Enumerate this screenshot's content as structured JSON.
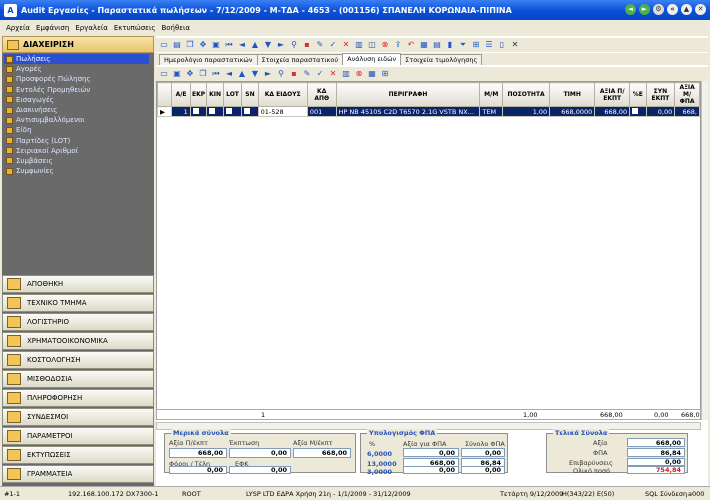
{
  "title": "Audit Εργασίες - Παραστατικά πωλήσεων - 7/12/2009 - Μ-ΤΔΑ - 4653 - (001156) ΣΠΑΝΕΛΗ ΚΟΡΩΝΑΙΑ-ΠΙΠΙΝΑ",
  "menu": [
    "Αρχεία",
    "Εμφάνιση",
    "Εργαλεία",
    "Εκτυπώσεις",
    "Βοήθεια"
  ],
  "sidebar": {
    "header": "ΔΙΑΧΕΙΡΙΣΗ",
    "items": [
      "Πωλήσεις",
      "Αγορές",
      "Προσφορές Πώλησης",
      "Εντολές Προμηθειών",
      "Εισαγωγές",
      "Διακινήσεις",
      "Αντισυμβαλλόμενοι",
      "Είδη",
      "Παρτίδες (LOT)",
      "Σειριακοί Αριθμοί",
      "Συμβάσεις",
      "Συμφωνίες"
    ],
    "modules": [
      "ΑΠΟΘΗΚΗ",
      "ΤΕΧΝΙΚΟ ΤΜΗΜΑ",
      "ΛΟΓΙΣΤΗΡΙΟ",
      "ΧΡΗΜΑΤΟΟΙΚΟΝΟΜΙΚΑ",
      "ΚΟΣΤΟΛΟΓΗΣΗ",
      "ΜΙΣΘΟΔΟΣΙΑ",
      "ΠΛΗΡΟΦΟΡΗΣΗ",
      "ΣΥΝΔΕΣΜΟΙ",
      "ΠΑΡΑΜΕΤΡΟΙ",
      "ΕΚΤΥΠΩΣΕΙΣ",
      "ΓΡΑΜΜΑΤΕΙΑ"
    ]
  },
  "tabs": [
    "Ημερολόγιο παραστατικών",
    "Στοιχεία παραστατικού",
    "Ανάλυση ειδών",
    "Στοιχεία τιμολόγησης"
  ],
  "grid": {
    "headers": [
      "Α/Ε",
      "ΕΚΡ",
      "ΚΙΝ",
      "LOT",
      "SN",
      "ΚΔ ΕΙΔΟΥΣ",
      "ΚΔ ΑΠΘ",
      "ΠΕΡΙΓΡΑΦΗ",
      "Μ/Μ",
      "ΠΟΣΟΤΗΤΑ",
      "ΤΙΜΗ",
      "ΑΞΙΑ Π/ΕΚΠΤ",
      "%Ε",
      "ΣΥΝ ΕΚΠΤ",
      "ΑΞΙΑ Μ/ΦΠΑ"
    ],
    "row": {
      "ae": "1",
      "code": "01-528",
      "apth": "001",
      "desc": "HP NB 4510S C2D T6570 2.1G VSTB NX...",
      "mm": "TEM",
      "qty": "1,00",
      "price": "668,0000",
      "value": "668,00",
      "disc": "0,00",
      "net": "668,"
    },
    "totals": {
      "count": "1",
      "qty": "1,00",
      "value": "668,00",
      "disc": "0,00",
      "net": "668,0"
    }
  },
  "partial": {
    "title": "Μερικά σύνολα",
    "l1": "Αξία Π/έκπτ",
    "l2": "Έκπτωση",
    "l3": "Αξία Μ/έκπτ",
    "l4": "Φόροι / Τέλη",
    "l5": "ΕΦΚ",
    "v1": "668,00",
    "v2": "0,00",
    "v3": "668,00",
    "v4": "0,00",
    "v5": "0,00"
  },
  "vat": {
    "title": "Υπολογισμός ΦΠΑ",
    "h1": "%",
    "h2": "Αξία για ΦΠΑ",
    "h3": "Σύνολο ΦΠΑ",
    "r1": [
      "6,0000",
      "0,00",
      "0,00"
    ],
    "r2": [
      "13,0000",
      "668,00",
      "86,84"
    ],
    "r3": [
      "3,0000",
      "0,00",
      "0,00"
    ]
  },
  "final": {
    "title": "Τελικά Σύνολα",
    "l1": "Αξία",
    "l2": "ΦΠΑ",
    "l3": "Επιβαρύνσεις",
    "l4": "Ολικό ποσό",
    "v1": "668,00",
    "v2": "86,84",
    "v3": "0,00",
    "v4": "754,84"
  },
  "status": {
    "s1": "#1-1",
    "s2": "192.168.100.172",
    "s3": "DX7300-1",
    "s4": "ROOT",
    "s5": "LYSP LTD ΕΔΡΑ Χρήση 21η - 1/1/2009 - 31/12/2009",
    "s6": "Τετάρτη 9/12/2009",
    "s7": "H(343/22) E(50)",
    "s8": "SQL Σύνδεση",
    "s9": "a000"
  }
}
